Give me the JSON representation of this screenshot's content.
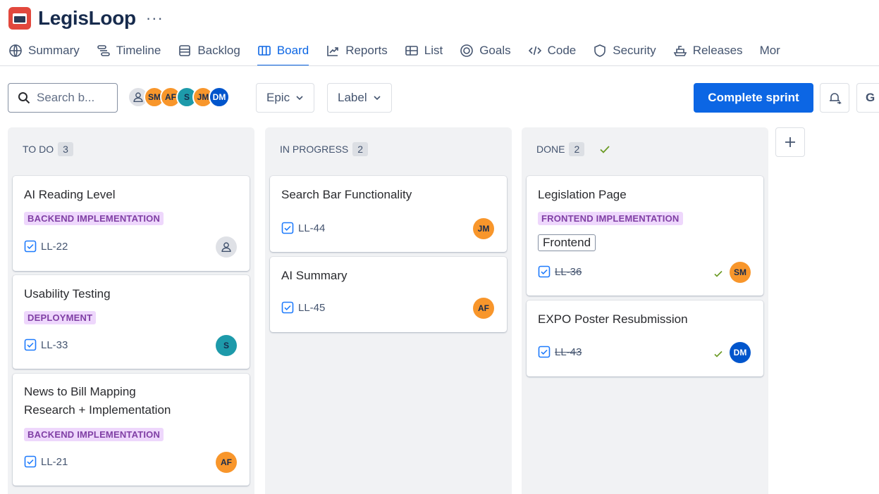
{
  "app": {
    "title": "LegisLoop",
    "more": "···"
  },
  "tabs": [
    {
      "label": "Summary",
      "icon": "globe-icon"
    },
    {
      "label": "Timeline",
      "icon": "timeline-icon"
    },
    {
      "label": "Backlog",
      "icon": "backlog-icon"
    },
    {
      "label": "Board",
      "icon": "board-icon",
      "active": true
    },
    {
      "label": "Reports",
      "icon": "reports-icon"
    },
    {
      "label": "List",
      "icon": "list-icon"
    },
    {
      "label": "Goals",
      "icon": "goals-icon"
    },
    {
      "label": "Code",
      "icon": "code-icon"
    },
    {
      "label": "Security",
      "icon": "shield-icon"
    },
    {
      "label": "Releases",
      "icon": "ship-icon"
    },
    {
      "label": "Mor",
      "icon": ""
    }
  ],
  "toolbar": {
    "search_placeholder": "Search b...",
    "avatars": [
      {
        "initials": "",
        "kind": "user"
      },
      {
        "initials": "SM",
        "kind": "orange"
      },
      {
        "initials": "AF",
        "kind": "orange"
      },
      {
        "initials": "S",
        "kind": "teal"
      },
      {
        "initials": "JM",
        "kind": "orange"
      },
      {
        "initials": "DM",
        "kind": "blue"
      }
    ],
    "epic_label": "Epic",
    "label_label": "Label",
    "complete_sprint": "Complete sprint",
    "cut_button": "G"
  },
  "colors": {
    "accent": "#0C66E4",
    "epic_bg": "#EED7FC",
    "epic_fg": "#803FA5",
    "done_check": "#6A9A23"
  },
  "columns": [
    {
      "title": "TO DO",
      "count": "3",
      "cards": [
        {
          "title": "AI Reading Level",
          "epic": "BACKEND IMPLEMENTATION",
          "key": "LL-22",
          "assignee": ""
        },
        {
          "title": "Usability Testing",
          "epic": "DEPLOYMENT",
          "key": "LL-33",
          "assignee": "S"
        },
        {
          "title_line1": "News to Bill Mapping",
          "title_line2": "Research + Implementation",
          "epic": "BACKEND IMPLEMENTATION",
          "key": "LL-21",
          "assignee": "AF"
        }
      ]
    },
    {
      "title": "IN PROGRESS",
      "count": "2",
      "cards": [
        {
          "title": "Search Bar Functionality",
          "key": "LL-44",
          "assignee": "JM"
        },
        {
          "title": "AI Summary",
          "key": "LL-45",
          "assignee": "AF"
        }
      ]
    },
    {
      "title": "DONE",
      "count": "2",
      "cards": [
        {
          "title": "Legislation Page",
          "epic": "FRONTEND IMPLEMENTATION",
          "label": "Frontend",
          "key": "LL-36",
          "assignee": "SM"
        },
        {
          "title": "EXPO Poster Resubmission",
          "key": "LL-43",
          "assignee": "DM"
        }
      ]
    }
  ],
  "add_column": "+"
}
